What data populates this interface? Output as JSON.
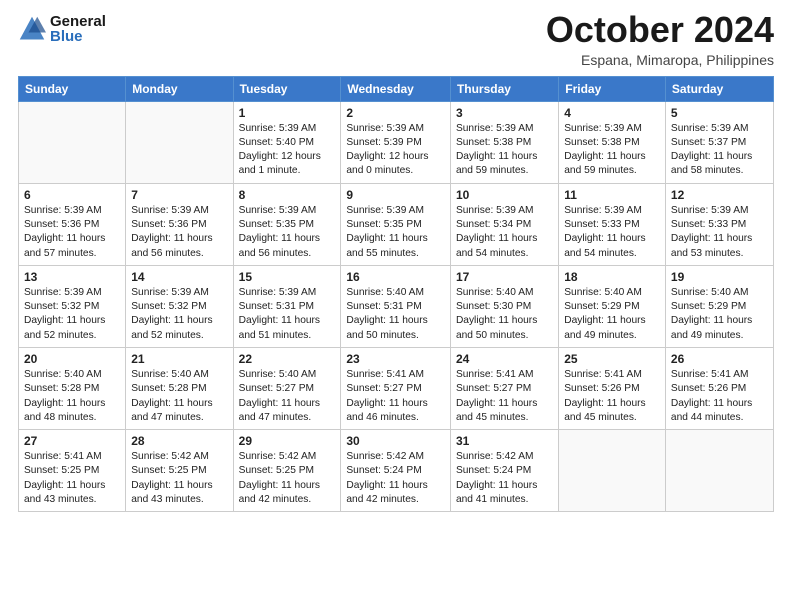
{
  "logo": {
    "general": "General",
    "blue": "Blue"
  },
  "title": "October 2024",
  "location": "Espana, Mimaropa, Philippines",
  "days_of_week": [
    "Sunday",
    "Monday",
    "Tuesday",
    "Wednesday",
    "Thursday",
    "Friday",
    "Saturday"
  ],
  "weeks": [
    [
      {
        "day": "",
        "content": ""
      },
      {
        "day": "",
        "content": ""
      },
      {
        "day": "1",
        "content": "Sunrise: 5:39 AM\nSunset: 5:40 PM\nDaylight: 12 hours\nand 1 minute."
      },
      {
        "day": "2",
        "content": "Sunrise: 5:39 AM\nSunset: 5:39 PM\nDaylight: 12 hours\nand 0 minutes."
      },
      {
        "day": "3",
        "content": "Sunrise: 5:39 AM\nSunset: 5:38 PM\nDaylight: 11 hours\nand 59 minutes."
      },
      {
        "day": "4",
        "content": "Sunrise: 5:39 AM\nSunset: 5:38 PM\nDaylight: 11 hours\nand 59 minutes."
      },
      {
        "day": "5",
        "content": "Sunrise: 5:39 AM\nSunset: 5:37 PM\nDaylight: 11 hours\nand 58 minutes."
      }
    ],
    [
      {
        "day": "6",
        "content": "Sunrise: 5:39 AM\nSunset: 5:36 PM\nDaylight: 11 hours\nand 57 minutes."
      },
      {
        "day": "7",
        "content": "Sunrise: 5:39 AM\nSunset: 5:36 PM\nDaylight: 11 hours\nand 56 minutes."
      },
      {
        "day": "8",
        "content": "Sunrise: 5:39 AM\nSunset: 5:35 PM\nDaylight: 11 hours\nand 56 minutes."
      },
      {
        "day": "9",
        "content": "Sunrise: 5:39 AM\nSunset: 5:35 PM\nDaylight: 11 hours\nand 55 minutes."
      },
      {
        "day": "10",
        "content": "Sunrise: 5:39 AM\nSunset: 5:34 PM\nDaylight: 11 hours\nand 54 minutes."
      },
      {
        "day": "11",
        "content": "Sunrise: 5:39 AM\nSunset: 5:33 PM\nDaylight: 11 hours\nand 54 minutes."
      },
      {
        "day": "12",
        "content": "Sunrise: 5:39 AM\nSunset: 5:33 PM\nDaylight: 11 hours\nand 53 minutes."
      }
    ],
    [
      {
        "day": "13",
        "content": "Sunrise: 5:39 AM\nSunset: 5:32 PM\nDaylight: 11 hours\nand 52 minutes."
      },
      {
        "day": "14",
        "content": "Sunrise: 5:39 AM\nSunset: 5:32 PM\nDaylight: 11 hours\nand 52 minutes."
      },
      {
        "day": "15",
        "content": "Sunrise: 5:39 AM\nSunset: 5:31 PM\nDaylight: 11 hours\nand 51 minutes."
      },
      {
        "day": "16",
        "content": "Sunrise: 5:40 AM\nSunset: 5:31 PM\nDaylight: 11 hours\nand 50 minutes."
      },
      {
        "day": "17",
        "content": "Sunrise: 5:40 AM\nSunset: 5:30 PM\nDaylight: 11 hours\nand 50 minutes."
      },
      {
        "day": "18",
        "content": "Sunrise: 5:40 AM\nSunset: 5:29 PM\nDaylight: 11 hours\nand 49 minutes."
      },
      {
        "day": "19",
        "content": "Sunrise: 5:40 AM\nSunset: 5:29 PM\nDaylight: 11 hours\nand 49 minutes."
      }
    ],
    [
      {
        "day": "20",
        "content": "Sunrise: 5:40 AM\nSunset: 5:28 PM\nDaylight: 11 hours\nand 48 minutes."
      },
      {
        "day": "21",
        "content": "Sunrise: 5:40 AM\nSunset: 5:28 PM\nDaylight: 11 hours\nand 47 minutes."
      },
      {
        "day": "22",
        "content": "Sunrise: 5:40 AM\nSunset: 5:27 PM\nDaylight: 11 hours\nand 47 minutes."
      },
      {
        "day": "23",
        "content": "Sunrise: 5:41 AM\nSunset: 5:27 PM\nDaylight: 11 hours\nand 46 minutes."
      },
      {
        "day": "24",
        "content": "Sunrise: 5:41 AM\nSunset: 5:27 PM\nDaylight: 11 hours\nand 45 minutes."
      },
      {
        "day": "25",
        "content": "Sunrise: 5:41 AM\nSunset: 5:26 PM\nDaylight: 11 hours\nand 45 minutes."
      },
      {
        "day": "26",
        "content": "Sunrise: 5:41 AM\nSunset: 5:26 PM\nDaylight: 11 hours\nand 44 minutes."
      }
    ],
    [
      {
        "day": "27",
        "content": "Sunrise: 5:41 AM\nSunset: 5:25 PM\nDaylight: 11 hours\nand 43 minutes."
      },
      {
        "day": "28",
        "content": "Sunrise: 5:42 AM\nSunset: 5:25 PM\nDaylight: 11 hours\nand 43 minutes."
      },
      {
        "day": "29",
        "content": "Sunrise: 5:42 AM\nSunset: 5:25 PM\nDaylight: 11 hours\nand 42 minutes."
      },
      {
        "day": "30",
        "content": "Sunrise: 5:42 AM\nSunset: 5:24 PM\nDaylight: 11 hours\nand 42 minutes."
      },
      {
        "day": "31",
        "content": "Sunrise: 5:42 AM\nSunset: 5:24 PM\nDaylight: 11 hours\nand 41 minutes."
      },
      {
        "day": "",
        "content": ""
      },
      {
        "day": "",
        "content": ""
      }
    ]
  ]
}
